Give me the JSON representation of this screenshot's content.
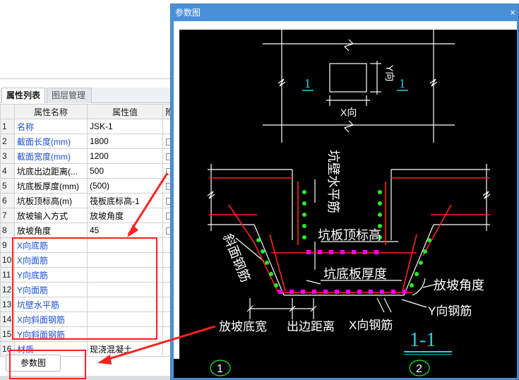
{
  "left_panel": {
    "tabs": [
      "属性列表",
      "图层管理"
    ],
    "columns": [
      "属性名称",
      "属性值",
      "附"
    ],
    "rows": [
      {
        "no": "1",
        "name": "名称",
        "value": "JSK-1",
        "blue": true,
        "check": false
      },
      {
        "no": "2",
        "name": "截面长度(mm)",
        "value": "1800",
        "blue": true,
        "check": true
      },
      {
        "no": "3",
        "name": "截面宽度(mm)",
        "value": "1200",
        "blue": true,
        "check": true
      },
      {
        "no": "4",
        "name": "坑底出边距离(...",
        "value": "500",
        "blue": false,
        "check": true
      },
      {
        "no": "5",
        "name": "坑底板厚度(mm)",
        "value": "(500)",
        "blue": false,
        "check": true
      },
      {
        "no": "6",
        "name": "坑板顶标高(m)",
        "value": "筏板底标高-1",
        "blue": false,
        "check": true
      },
      {
        "no": "7",
        "name": "放坡输入方式",
        "value": "放坡角度",
        "blue": false,
        "check": true
      },
      {
        "no": "8",
        "name": "放坡角度",
        "value": "45",
        "blue": false,
        "check": true
      },
      {
        "no": "9",
        "name": "X向底筋",
        "value": "",
        "blue": true,
        "check": false
      },
      {
        "no": "10",
        "name": "X向面筋",
        "value": "",
        "blue": true,
        "check": false
      },
      {
        "no": "11",
        "name": "Y向底筋",
        "value": "",
        "blue": true,
        "check": false
      },
      {
        "no": "12",
        "name": "Y向面筋",
        "value": "",
        "blue": true,
        "check": false
      },
      {
        "no": "13",
        "name": "坑壁水平筋",
        "value": "",
        "blue": true,
        "check": false
      },
      {
        "no": "14",
        "name": "X向斜面钢筋",
        "value": "",
        "blue": true,
        "check": false
      },
      {
        "no": "15",
        "name": "Y向斜面钢筋",
        "value": "",
        "blue": true,
        "check": false
      },
      {
        "no": "16",
        "name": "材质",
        "value": "现浇混凝土",
        "blue": true,
        "check": false
      }
    ],
    "param_button": "参数图"
  },
  "dialog": {
    "title": "参数图",
    "close": "×",
    "drawing": {
      "plan_mark_left": "1",
      "plan_mark_right": "1",
      "plan_x_label": "X向",
      "plan_y_label": "Y向",
      "wall_bar_label": "坑壁水平筋",
      "top_elev_label": "坑板顶标高",
      "slope_bar_label": "斜面钢筋",
      "slab_thk_label": "坑底板厚度",
      "slope_angle_label": "放坡角度",
      "y_bar_label": "Y向钢筋",
      "slope_width_label": "放坡底宽",
      "edge_dist_label": "出边距离",
      "x_bar_label": "X向钢筋",
      "section_label": "1-1",
      "grid_1": "1",
      "grid_2": "2"
    }
  },
  "colors": {
    "annotation_red": "#ff2020",
    "rebar_green": "#22ee22",
    "rebar_magenta": "#ff00ff",
    "cad_bg": "#000000",
    "section_cyan": "#22d4e0",
    "dialog_blue": "#4a90d9"
  }
}
